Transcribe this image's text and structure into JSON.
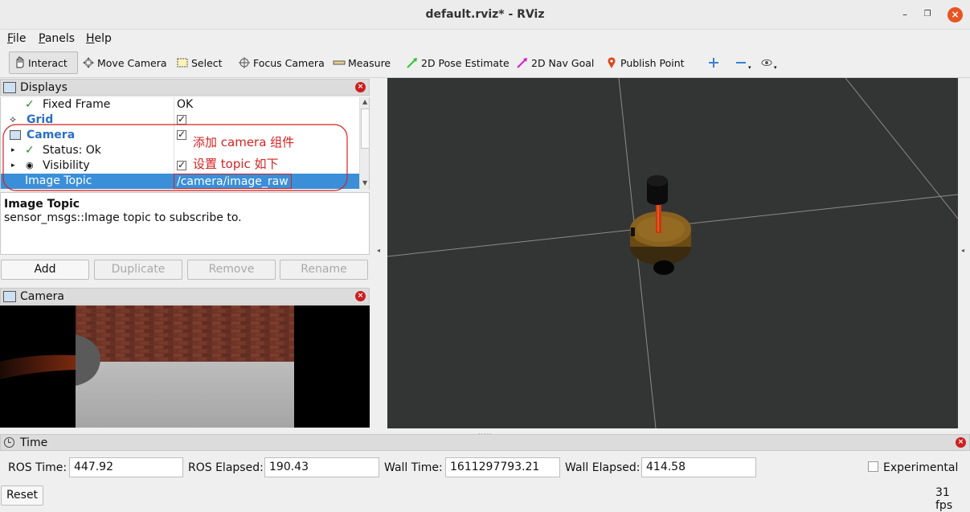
{
  "window": {
    "title": "default.rviz* - RViz"
  },
  "menu": {
    "file": "File",
    "panels": "Panels",
    "help": "Help"
  },
  "toolbar": {
    "interact": "Interact",
    "move_camera": "Move Camera",
    "select": "Select",
    "focus_camera": "Focus Camera",
    "measure": "Measure",
    "pose_estimate": "2D Pose Estimate",
    "nav_goal": "2D Nav Goal",
    "publish_point": "Publish Point"
  },
  "displays": {
    "title": "Displays",
    "rows": [
      {
        "label": "Fixed Frame",
        "value": "OK"
      },
      {
        "label": "Grid",
        "value": ""
      },
      {
        "label": "Camera",
        "value": ""
      },
      {
        "label": "Status: Ok",
        "value": ""
      },
      {
        "label": "Visibility",
        "value": ""
      },
      {
        "label": "Image Topic",
        "value": "/camera/image_raw"
      }
    ],
    "annotation_1": "添加 camera 组件",
    "annotation_2": "设置 topic 如下"
  },
  "description": {
    "title": "Image Topic",
    "text": "sensor_msgs::Image topic to subscribe to."
  },
  "buttons": {
    "add": "Add",
    "duplicate": "Duplicate",
    "remove": "Remove",
    "rename": "Rename"
  },
  "camera_panel": {
    "title": "Camera"
  },
  "time_panel": {
    "title": "Time",
    "ros_time_label": "ROS Time:",
    "ros_time": "447.92",
    "ros_elapsed_label": "ROS Elapsed:",
    "ros_elapsed": "190.43",
    "wall_time_label": "Wall Time:",
    "wall_time": "1611297793.21",
    "wall_elapsed_label": "Wall Elapsed:",
    "wall_elapsed": "414.58",
    "experimental": "Experimental",
    "reset": "Reset",
    "fps": "31 fps"
  },
  "colors": {
    "accent": "#e95420",
    "selection": "#3a8fd8",
    "annotation": "#d42222",
    "viewport_bg": "#333534"
  }
}
